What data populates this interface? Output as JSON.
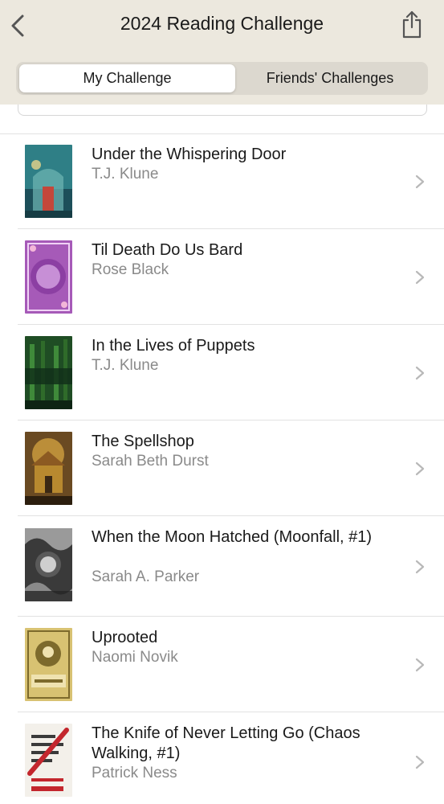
{
  "header": {
    "title": "2024 Reading Challenge",
    "back_icon": "chevron-left-icon",
    "share_icon": "share-icon"
  },
  "tabs": [
    {
      "label": "My Challenge",
      "selected": true
    },
    {
      "label": "Friends' Challenges",
      "selected": false
    }
  ],
  "books": [
    {
      "title": "Under the Whispering Door",
      "author": "T.J. Klune",
      "cover_colors": [
        "#2f7f86",
        "#1d4f5a"
      ]
    },
    {
      "title": "Til Death Do Us Bard",
      "author": "Rose Black",
      "cover_colors": [
        "#a65ab8",
        "#6b2f82"
      ]
    },
    {
      "title": "In the Lives of Puppets",
      "author": "T.J. Klune",
      "cover_colors": [
        "#2f6b2a",
        "#12301a"
      ]
    },
    {
      "title": "The Spellshop",
      "author": "Sarah Beth Durst",
      "cover_colors": [
        "#b8892f",
        "#4a3418"
      ]
    },
    {
      "title": "When the Moon Hatched (Moonfall, #1)",
      "author": "Sarah A. Parker",
      "cover_colors": [
        "#6f6f6f",
        "#262626"
      ]
    },
    {
      "title": "Uprooted",
      "author": "Naomi Novik",
      "cover_colors": [
        "#d8c272",
        "#7d6a2c"
      ]
    },
    {
      "title": "The Knife of Never Letting Go (Chaos Walking, #1)",
      "author": "Patrick Ness",
      "cover_colors": [
        "#f3f0ea",
        "#c3262d"
      ]
    }
  ]
}
